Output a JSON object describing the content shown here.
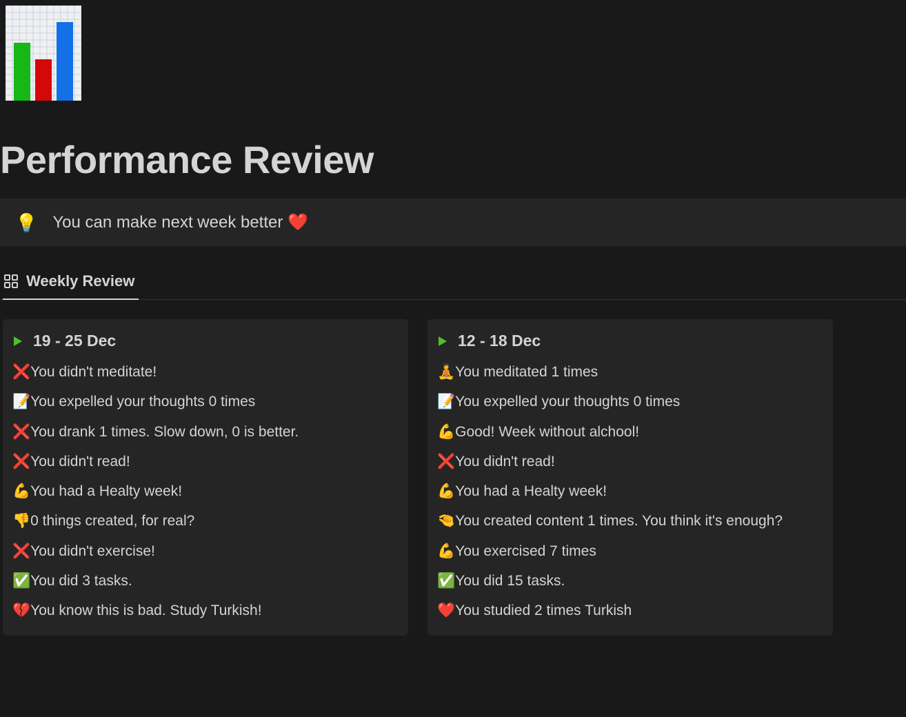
{
  "header": {
    "title": "Performance Review"
  },
  "callout": {
    "icon": "💡",
    "text": "You can make next week better ❤️"
  },
  "tabs": {
    "active": "Weekly Review"
  },
  "cards": [
    {
      "title": "19 - 25 Dec",
      "lines": [
        {
          "emoji": "❌",
          "text": "You didn't meditate!"
        },
        {
          "emoji": "📝",
          "text": "You expelled your thoughts 0 times"
        },
        {
          "emoji": "❌",
          "text": "You drank 1 times. Slow down, 0 is better."
        },
        {
          "emoji": "❌",
          "text": "You didn't read!"
        },
        {
          "emoji": "💪",
          "text": "You had a Healty week!"
        },
        {
          "emoji": "👎",
          "text": "0 things created, for real?"
        },
        {
          "emoji": "❌",
          "text": "You didn't exercise!"
        },
        {
          "emoji": "✅",
          "text": "You did 3 tasks."
        },
        {
          "emoji": "💔",
          "text": "You know this is bad. Study Turkish!"
        }
      ]
    },
    {
      "title": "12 - 18 Dec",
      "lines": [
        {
          "emoji": "🧘",
          "text": "You meditated 1 times"
        },
        {
          "emoji": "📝",
          "text": "You expelled your thoughts 0 times"
        },
        {
          "emoji": "💪",
          "text": "Good! Week without alchool!"
        },
        {
          "emoji": "❌",
          "text": "You didn't read!"
        },
        {
          "emoji": "💪",
          "text": "You had a Healty week!"
        },
        {
          "emoji": "🤏",
          "text": "You created content 1 times. You think it's enough?"
        },
        {
          "emoji": "💪",
          "text": "You exercised 7 times"
        },
        {
          "emoji": "✅",
          "text": "You did 15 tasks."
        },
        {
          "emoji": "❤️",
          "text": "You studied 2 times Turkish"
        }
      ]
    }
  ]
}
